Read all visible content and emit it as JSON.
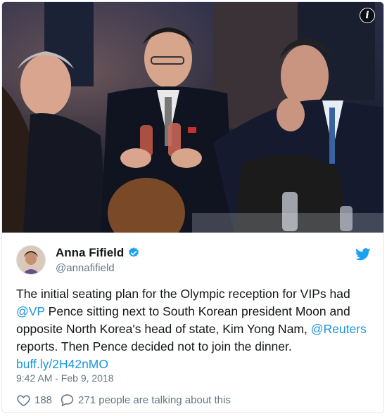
{
  "tweet": {
    "author_name": "Anna Fifield",
    "author_handle": "@annafifield",
    "text_1": "The initial seating plan for the Olympic reception for VIPs had ",
    "mention_vp": "@VP",
    "text_2": " Pence sitting next to South Korean president Moon and opposite North Korea's head of state, Kim Yong Nam, ",
    "mention_reuters": "@Reuters",
    "text_3": " reports. Then Pence decided not to join the dinner.",
    "link": "buff.ly/2H42nMO",
    "timestamp": "9:42 AM - Feb 9, 2018",
    "like_count": "188",
    "talking_text": "271 people are talking about this"
  },
  "photo": {
    "info_label": "i"
  },
  "colors": {
    "link": "#1b95e0",
    "muted": "#657786",
    "text": "#14171a",
    "twitter_blue": "#1da1f2"
  },
  "icons": [
    "info-icon",
    "verified-badge-icon",
    "twitter-bird-icon",
    "heart-icon",
    "comment-bubble-icon"
  ]
}
